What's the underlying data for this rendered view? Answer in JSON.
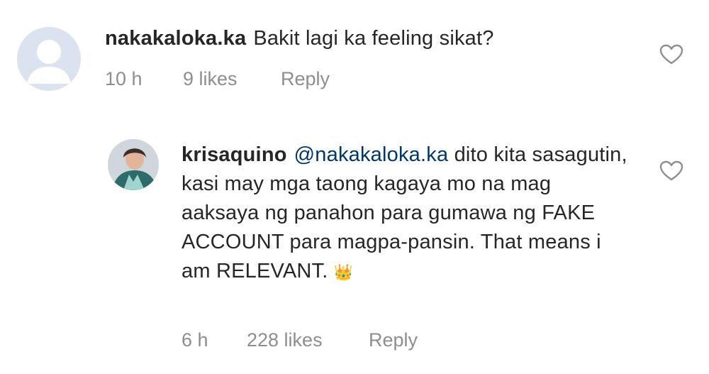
{
  "comments": [
    {
      "username": "nakakaloka.ka",
      "text": "Bakit lagi ka feeling sikat?",
      "time": "10 h",
      "likes": "9 likes",
      "reply_label": "Reply"
    },
    {
      "username": "krisaquino",
      "mention": "@nakakaloka.ka",
      "text": "dito kita sasagutin, kasi may mga taong kagaya mo na mag aaksaya ng panahon para gumawa ng FAKE ACCOUNT para magpa-pansin. That means i am RELEVANT.",
      "emoji": "👑",
      "time": "6 h",
      "likes": "228 likes",
      "reply_label": "Reply"
    }
  ],
  "colors": {
    "default_avatar_bg": "#dbe3f0",
    "mention": "#00376b",
    "meta": "#8e8e8e"
  },
  "icons": {
    "like": "heart-icon",
    "default_avatar": "user-silhouette-icon"
  }
}
